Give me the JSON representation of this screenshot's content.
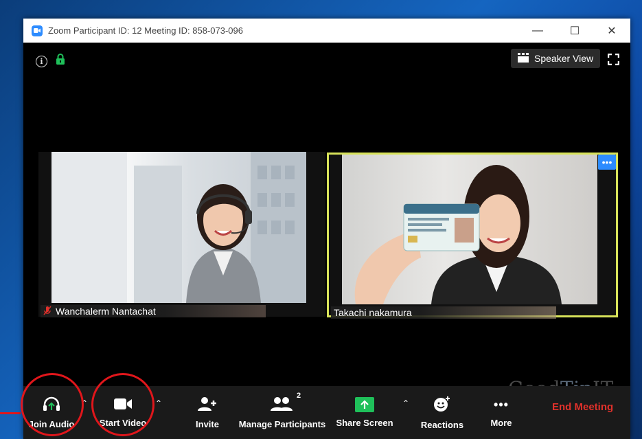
{
  "window": {
    "title": "Zoom Participant ID: 12   Meeting ID: 858-073-096",
    "controls": [
      "—",
      "☐",
      "✕"
    ]
  },
  "meeting": {
    "speaker_view_label": "Speaker View",
    "participants": [
      {
        "name": "Wanchalerm Nantachat",
        "muted": true
      },
      {
        "name": "Takachi nakamura",
        "active_speaker": true
      }
    ],
    "watermark_part1": "Good",
    "watermark_part2": "Tip",
    "watermark_part3": "IT"
  },
  "toolbar": {
    "join_audio": "Join Audio",
    "start_video": "Start Video",
    "invite": "Invite",
    "manage_participants": "Manage Participants",
    "participant_count": "2",
    "share_screen": "Share Screen",
    "reactions": "Reactions",
    "more": "More",
    "end_meeting": "End Meeting"
  },
  "colors": {
    "accent": "#2d8cff",
    "active_border": "#d8e35a",
    "end_meeting": "#e0312b",
    "share_green": "#1fc05a",
    "annotation": "#e0161b"
  }
}
